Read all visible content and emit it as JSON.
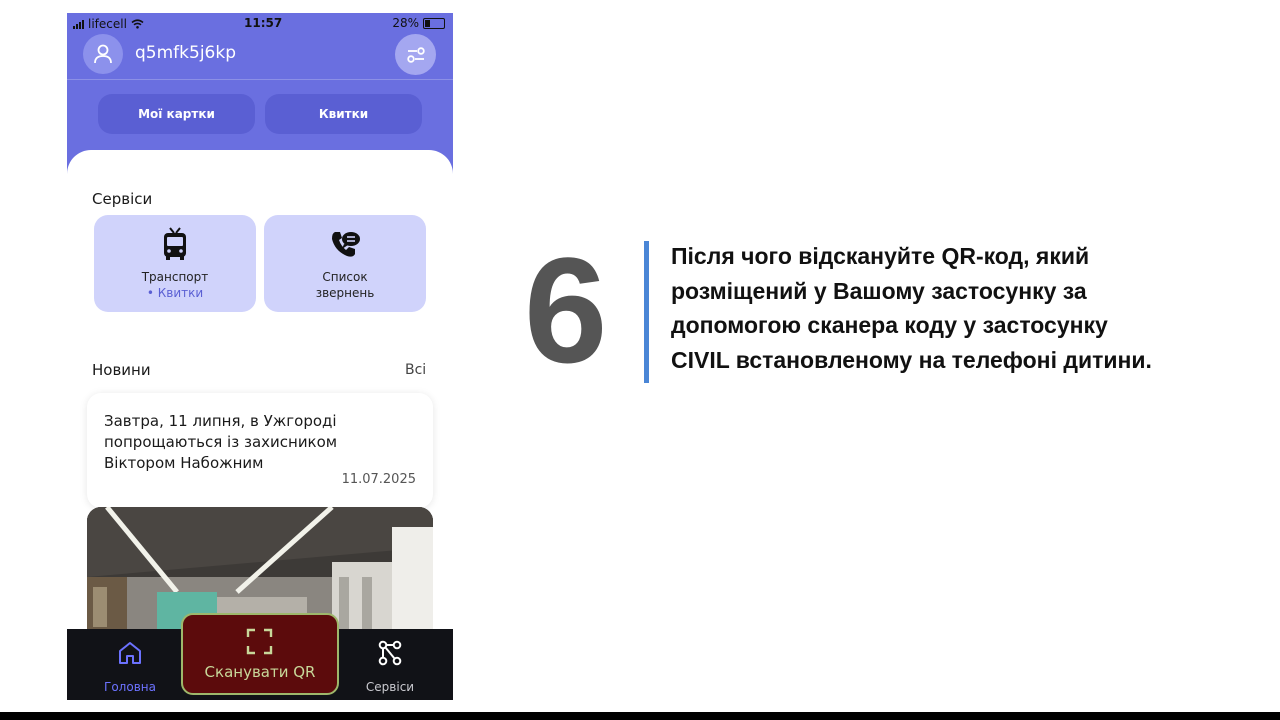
{
  "status_bar": {
    "carrier": "lifecell",
    "time": "11:57",
    "battery": "28%"
  },
  "header": {
    "username": "q5mfk5j6kp"
  },
  "top_buttons": {
    "my_cards": "Мої картки",
    "tickets": "Квитки"
  },
  "services": {
    "title": "Сервіси",
    "items": [
      {
        "label": "Транспорт",
        "sub": "• Квитки",
        "icon": "trolleybus-icon"
      },
      {
        "label_line1": "Список",
        "label_line2": "звернень",
        "icon": "chat-phone-icon"
      }
    ]
  },
  "news": {
    "title": "Новини",
    "all_link": "Всі",
    "items": [
      {
        "line1": "Завтра, 11 липня, в Ужгороді",
        "line2": "попрощаються із захисником",
        "line3": "Віктором Набожним",
        "date": "11.07.2025"
      }
    ]
  },
  "tabbar": {
    "home": "Головна",
    "scan": "Сканувати QR",
    "services": "Сервіси"
  },
  "step": {
    "number": "6",
    "line1": "Після чого відскануйте QR-код, який",
    "line2": "розміщений у Вашому застосунку за",
    "line3": "допомогою сканера коду у застосунку",
    "line4": "CIVIL встановленому на телефоні дитини."
  },
  "colors": {
    "header": "#6a6fe0",
    "pill": "#5a5fd3",
    "service_card": "#d0d3fb",
    "scan_button": "#5c0b0c",
    "accent_line": "#4a86d6",
    "step_number": "#555555"
  }
}
